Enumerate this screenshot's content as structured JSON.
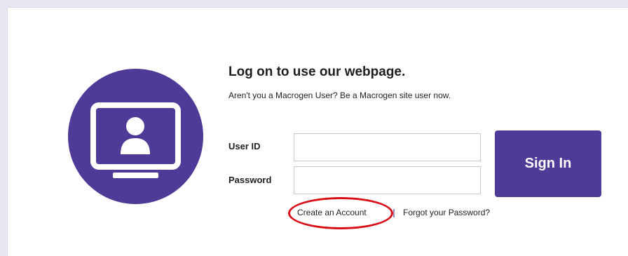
{
  "login": {
    "title": "Log on to use our webpage.",
    "subtitle": "Aren't you a Macrogen User? Be a Macrogen site user now.",
    "user_id_label": "User ID",
    "user_id_value": "",
    "password_label": "Password",
    "password_value": "",
    "sign_in_label": "Sign In",
    "create_account_label": "Create an Account",
    "forgot_password_label": "Forgot your Password?"
  },
  "colors": {
    "brand_purple": "#4f3a97",
    "annotation_red": "#d90f16",
    "frame_gray": "#e8e6f0"
  },
  "icons": {
    "hero": "monitor-user-icon"
  }
}
